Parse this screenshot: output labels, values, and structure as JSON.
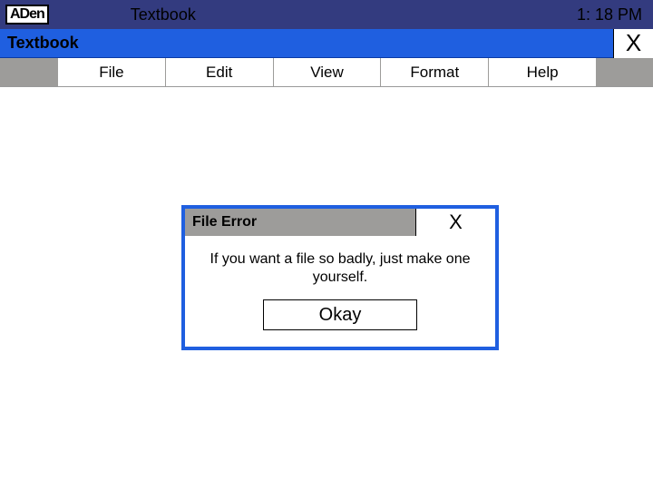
{
  "logo_text": "ADen",
  "topbar": {
    "title": "Textbook",
    "clock": "1: 18 PM"
  },
  "window": {
    "title": "Textbook",
    "close_label": "X"
  },
  "menubar": {
    "items": [
      "File",
      "Edit",
      "View",
      "Format",
      "Help"
    ]
  },
  "dialog": {
    "title": "File Error",
    "close_label": "X",
    "message": "If you want a file so badly, just make one yourself.",
    "ok_label": "Okay"
  }
}
